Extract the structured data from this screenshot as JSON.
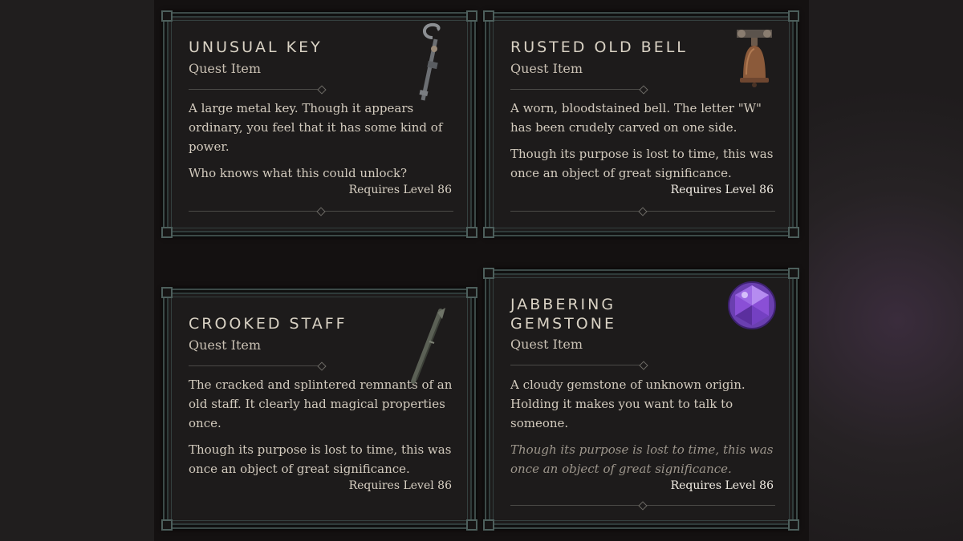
{
  "cards": [
    {
      "title": "Unusual Key",
      "subtitle": "Quest Item",
      "paragraphs": [
        "A large metal key. Though it appears ordinary, you feel that it has some kind of power.",
        "Who knows what this could unlock?"
      ],
      "requirement": "Requires Level 86",
      "icon": "key-icon"
    },
    {
      "title": "Rusted Old Bell",
      "subtitle": "Quest Item",
      "paragraphs": [
        "A worn, bloodstained bell. The letter \"W\" has been crudely carved on one side.",
        "Though its purpose is lost to time, this was once an object of great significance."
      ],
      "requirement": "Requires Level 86",
      "icon": "bell-icon"
    },
    {
      "title": "Crooked Staff",
      "subtitle": "Quest Item",
      "paragraphs": [
        "The cracked and splintered remnants of an old staff. It clearly had magical properties once.",
        "Though its purpose is lost to time, this was once an object of great significance."
      ],
      "requirement": "Requires Level 86",
      "icon": "staff-icon"
    },
    {
      "title": "Jabbering Gemstone",
      "subtitle": "Quest Item",
      "paragraphs": [
        "A cloudy gemstone of unknown origin. Holding it makes you want to talk to someone.",
        "Though its purpose is lost to time, this was once an object of great significance."
      ],
      "requirement": "Requires Level 86",
      "icon": "gemstone-icon"
    }
  ],
  "colors": {
    "frame": "#3c4a48",
    "card_background": "#1d1b1b",
    "text": "#d3cbbe",
    "gem": "#8a4fd6"
  }
}
